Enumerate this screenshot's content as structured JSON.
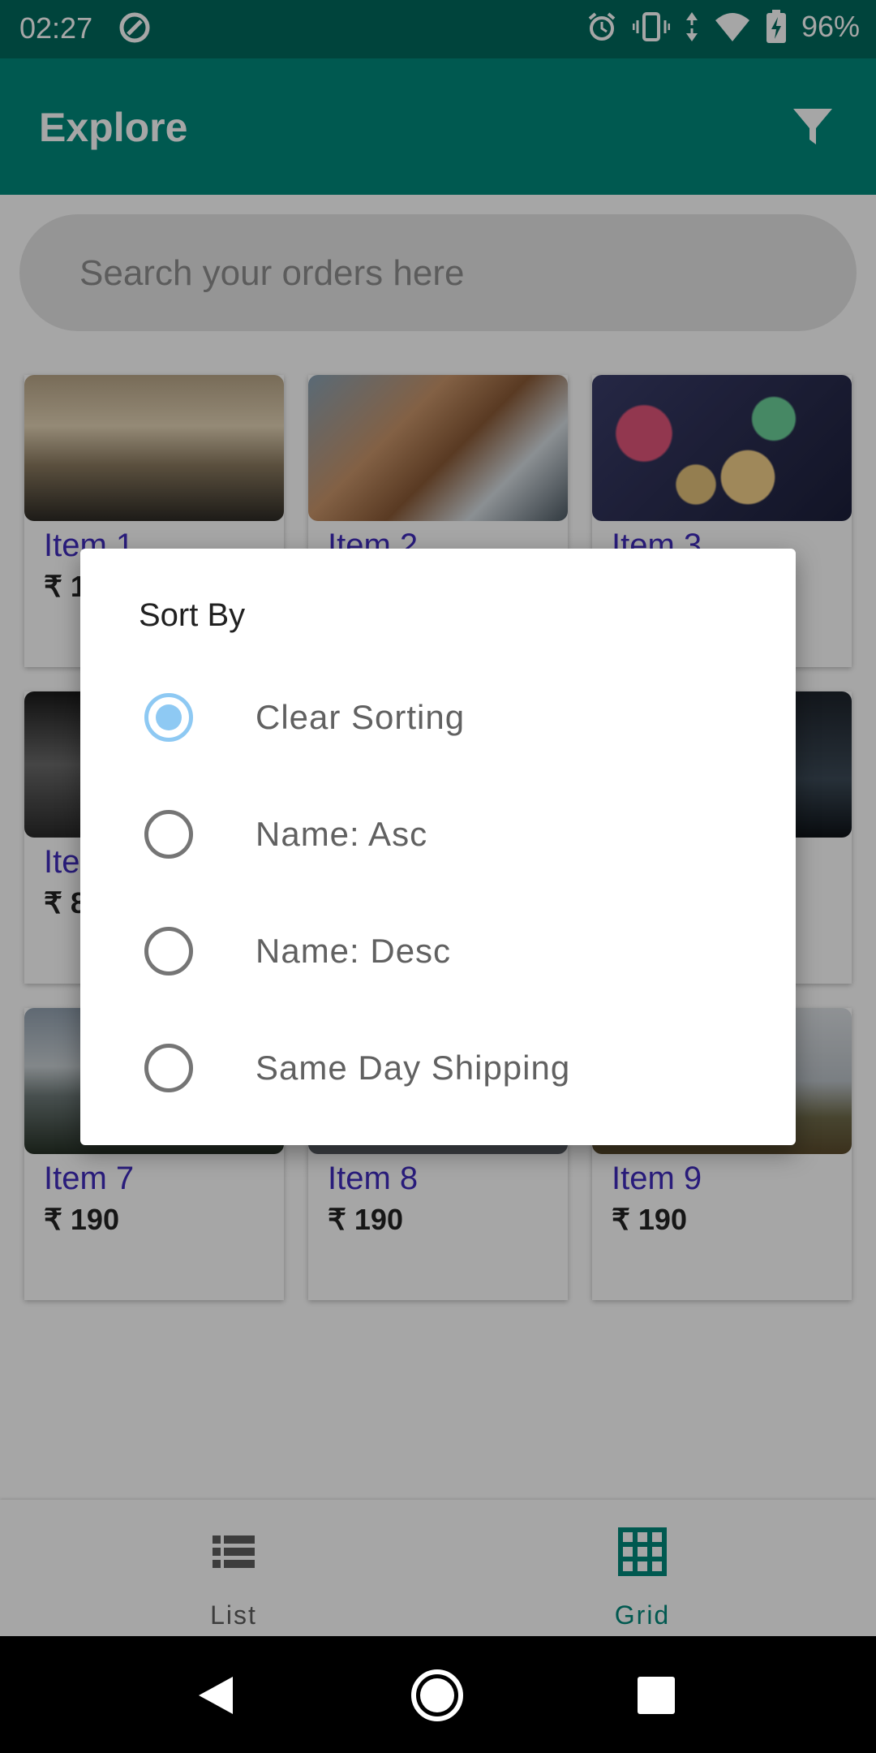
{
  "status_bar": {
    "time": "02:27",
    "battery": "96%",
    "icons": [
      "at-sign-icon",
      "alarm-icon",
      "vibrate-icon",
      "data-arrows-icon",
      "wifi-icon",
      "battery-charging-icon"
    ]
  },
  "app_bar": {
    "title": "Explore",
    "filter_icon": "filter-icon"
  },
  "search": {
    "placeholder": "Search your orders here",
    "value": ""
  },
  "grid": {
    "items": [
      {
        "name": "Item 1",
        "price": "₹ 1"
      },
      {
        "name": "Item 2",
        "price": ""
      },
      {
        "name": "Item 3",
        "price": ""
      },
      {
        "name": "Ite",
        "price": "₹ 8"
      },
      {
        "name": "",
        "price": ""
      },
      {
        "name": "",
        "price": ""
      },
      {
        "name": "Item 7",
        "price": "₹ 190"
      },
      {
        "name": "Item 8",
        "price": "₹ 190"
      },
      {
        "name": "Item 9",
        "price": "₹ 190"
      }
    ]
  },
  "dialog": {
    "title": "Sort By",
    "options": [
      {
        "label": "Clear Sorting",
        "selected": true
      },
      {
        "label": "Name: Asc",
        "selected": false
      },
      {
        "label": "Name: Desc",
        "selected": false
      },
      {
        "label": "Same Day Shipping",
        "selected": false
      }
    ]
  },
  "bottom_nav": {
    "list_label": "List",
    "grid_label": "Grid",
    "active": "Grid"
  },
  "colors": {
    "primary": "#00897b",
    "primary_dark": "#00695c",
    "item_name": "#3f2bbd",
    "radio_selected": "#8ec9f3"
  }
}
